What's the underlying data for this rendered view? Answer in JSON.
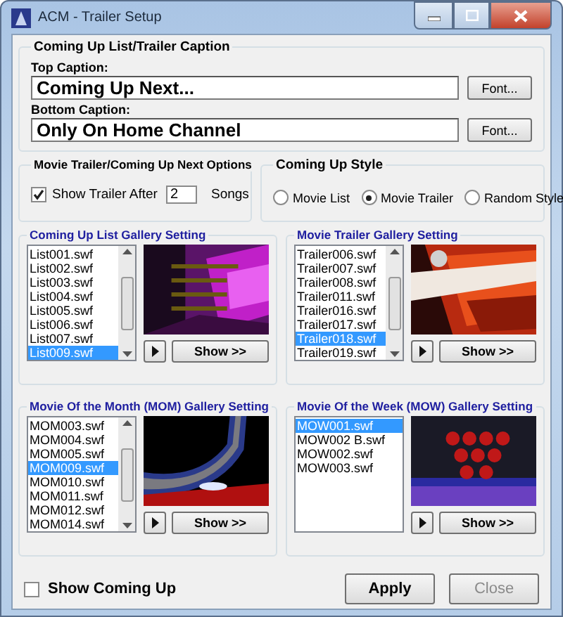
{
  "window": {
    "title": "ACM - Trailer Setup"
  },
  "caption_group": {
    "title": "Coming Up List/Trailer Caption",
    "fields": [
      {
        "label": "Top Caption:",
        "value": "Coming Up Next...",
        "button": "Font..."
      },
      {
        "label": "Bottom Caption:",
        "value": "Only On Home Channel",
        "button": "Font..."
      }
    ]
  },
  "options_group": {
    "title": "Movie Trailer/Coming Up Next Options",
    "show_trailer": {
      "label": "Show Trailer After",
      "checked": true
    },
    "songs_value": "2",
    "songs_label": "Songs"
  },
  "style_group": {
    "title": "Coming Up Style",
    "options": [
      {
        "label": "Movie List",
        "selected": false
      },
      {
        "label": "Movie Trailer",
        "selected": true
      },
      {
        "label": "Random Style",
        "selected": false
      }
    ]
  },
  "galleries": [
    {
      "title": "Coming Up List Gallery Setting",
      "scrollable": true,
      "show_button": "Show >>",
      "items": [
        {
          "label": "List001.swf",
          "selected": false
        },
        {
          "label": "List002.swf",
          "selected": false
        },
        {
          "label": "List003.swf",
          "selected": false
        },
        {
          "label": "List004.swf",
          "selected": false
        },
        {
          "label": "List005.swf",
          "selected": false
        },
        {
          "label": "List006.swf",
          "selected": false
        },
        {
          "label": "List007.swf",
          "selected": false
        },
        {
          "label": "List009.swf",
          "selected": true
        }
      ]
    },
    {
      "title": "Movie Trailer Gallery Setting",
      "scrollable": true,
      "show_button": "Show >>",
      "items": [
        {
          "label": "Trailer006.swf",
          "selected": false
        },
        {
          "label": "Trailer007.swf",
          "selected": false
        },
        {
          "label": "Trailer008.swf",
          "selected": false
        },
        {
          "label": "Trailer011.swf",
          "selected": false
        },
        {
          "label": "Trailer016.swf",
          "selected": false
        },
        {
          "label": "Trailer017.swf",
          "selected": false
        },
        {
          "label": "Trailer018.swf",
          "selected": true
        },
        {
          "label": "Trailer019.swf",
          "selected": false
        }
      ]
    },
    {
      "title": "Movie Of the Month (MOM) Gallery Setting",
      "scrollable": true,
      "show_button": "Show >>",
      "items": [
        {
          "label": "MOM003.swf",
          "selected": false
        },
        {
          "label": "MOM004.swf",
          "selected": false
        },
        {
          "label": "MOM005.swf",
          "selected": false
        },
        {
          "label": "MOM009.swf",
          "selected": true
        },
        {
          "label": "MOM010.swf",
          "selected": false
        },
        {
          "label": "MOM011.swf",
          "selected": false
        },
        {
          "label": "MOM012.swf",
          "selected": false
        },
        {
          "label": "MOM014.swf",
          "selected": false
        }
      ]
    },
    {
      "title": "Movie Of the Week (MOW) Gallery Setting",
      "scrollable": false,
      "show_button": "Show >>",
      "items": [
        {
          "label": "MOW001.swf",
          "selected": true
        },
        {
          "label": "MOW002 B.swf",
          "selected": false
        },
        {
          "label": "MOW002.swf",
          "selected": false
        },
        {
          "label": "MOW003.swf",
          "selected": false
        }
      ]
    }
  ],
  "show_coming_up": {
    "label": "Show Coming Up",
    "checked": false
  },
  "buttons": [
    {
      "label": "Apply",
      "disabled": false
    },
    {
      "label": "Close",
      "disabled": true
    }
  ]
}
